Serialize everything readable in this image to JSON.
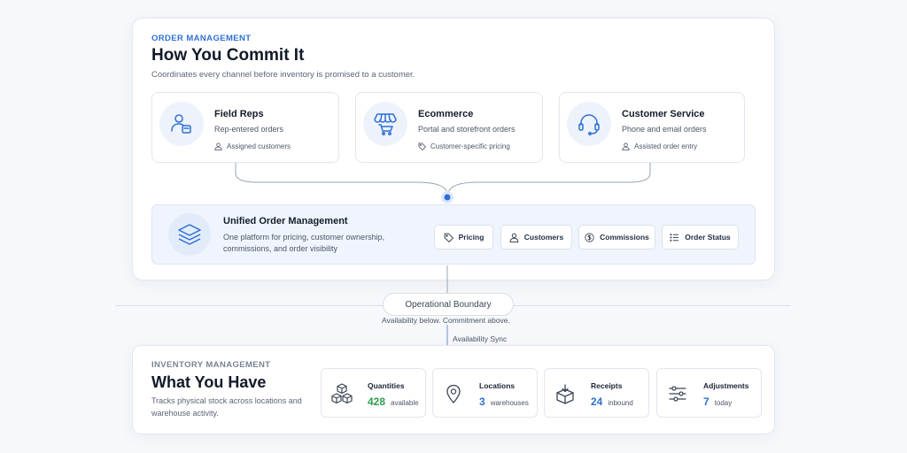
{
  "order": {
    "eyebrow": "ORDER MANAGEMENT",
    "title": "How You Commit It",
    "subtitle": "Coordinates every channel before inventory is promised to a customer."
  },
  "channels": [
    {
      "name": "Field Reps",
      "desc": "Rep-entered orders",
      "meta": "Assigned customers",
      "icon": "field-rep-icon",
      "meta_icon": "person-icon"
    },
    {
      "name": "Ecommerce",
      "desc": "Portal and storefront orders",
      "meta": "Customer-specific pricing",
      "icon": "storefront-cart-icon",
      "meta_icon": "tag-icon"
    },
    {
      "name": "Customer Service",
      "desc": "Phone and email orders",
      "meta": "Assisted order entry",
      "icon": "headset-icon",
      "meta_icon": "person-icon"
    }
  ],
  "unified": {
    "title": "Unified Order Management",
    "desc": "One platform for pricing, customer ownership, commissions, and order visibility",
    "icon": "layers-icon",
    "pills": [
      {
        "label": "Pricing",
        "icon": "tag-icon"
      },
      {
        "label": "Customers",
        "icon": "person-icon"
      },
      {
        "label": "Commissions",
        "icon": "dollar-circle-icon"
      },
      {
        "label": "Order Status",
        "icon": "list-icon"
      }
    ]
  },
  "boundary": {
    "label": "Operational Boundary",
    "note": "Availability below. Commitment above.",
    "sync": "Availability Sync"
  },
  "inventory": {
    "eyebrow": "INVENTORY MANAGEMENT",
    "title": "What You Have",
    "subtitle": "Tracks physical stock across locations and warehouse activity.",
    "metrics": [
      {
        "label": "Quantities",
        "value": "428",
        "unit": "available",
        "icon": "boxes-icon",
        "color": "#2e9e4f"
      },
      {
        "label": "Locations",
        "value": "3",
        "unit": "warehouses",
        "icon": "map-pin-icon",
        "color": "#2f6fd6"
      },
      {
        "label": "Receipts",
        "value": "24",
        "unit": "inbound",
        "icon": "box-arrow-icon",
        "color": "#2f6fd6"
      },
      {
        "label": "Adjustments",
        "value": "7",
        "unit": "today",
        "icon": "sliders-icon",
        "color": "#2f6fd6"
      }
    ]
  },
  "colors": {
    "accent": "#2f6fd6",
    "green": "#2e9e4f"
  }
}
